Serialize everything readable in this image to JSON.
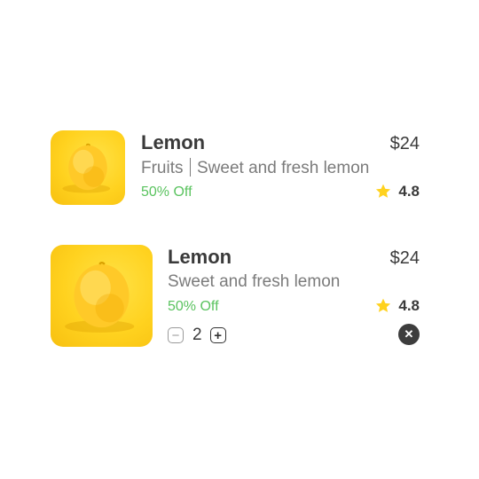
{
  "products": [
    {
      "name": "Lemon",
      "category": "Fruits",
      "description": "Sweet and fresh lemon",
      "price": "$24",
      "discount": "50% Off",
      "rating": "4.8",
      "image_icon": "lemon-image"
    },
    {
      "name": "Lemon",
      "description": "Sweet and fresh lemon",
      "price": "$24",
      "discount": "50% Off",
      "rating": "4.8",
      "quantity": "2",
      "minus_symbol": "−",
      "plus_symbol": "+",
      "remove_symbol": "✕",
      "image_icon": "lemon-image"
    }
  ],
  "colors": {
    "accent_yellow": "#ffd21f",
    "discount_green": "#5ac35f",
    "star_yellow": "#ffd21f",
    "remove_bg": "#3d3d3d"
  }
}
